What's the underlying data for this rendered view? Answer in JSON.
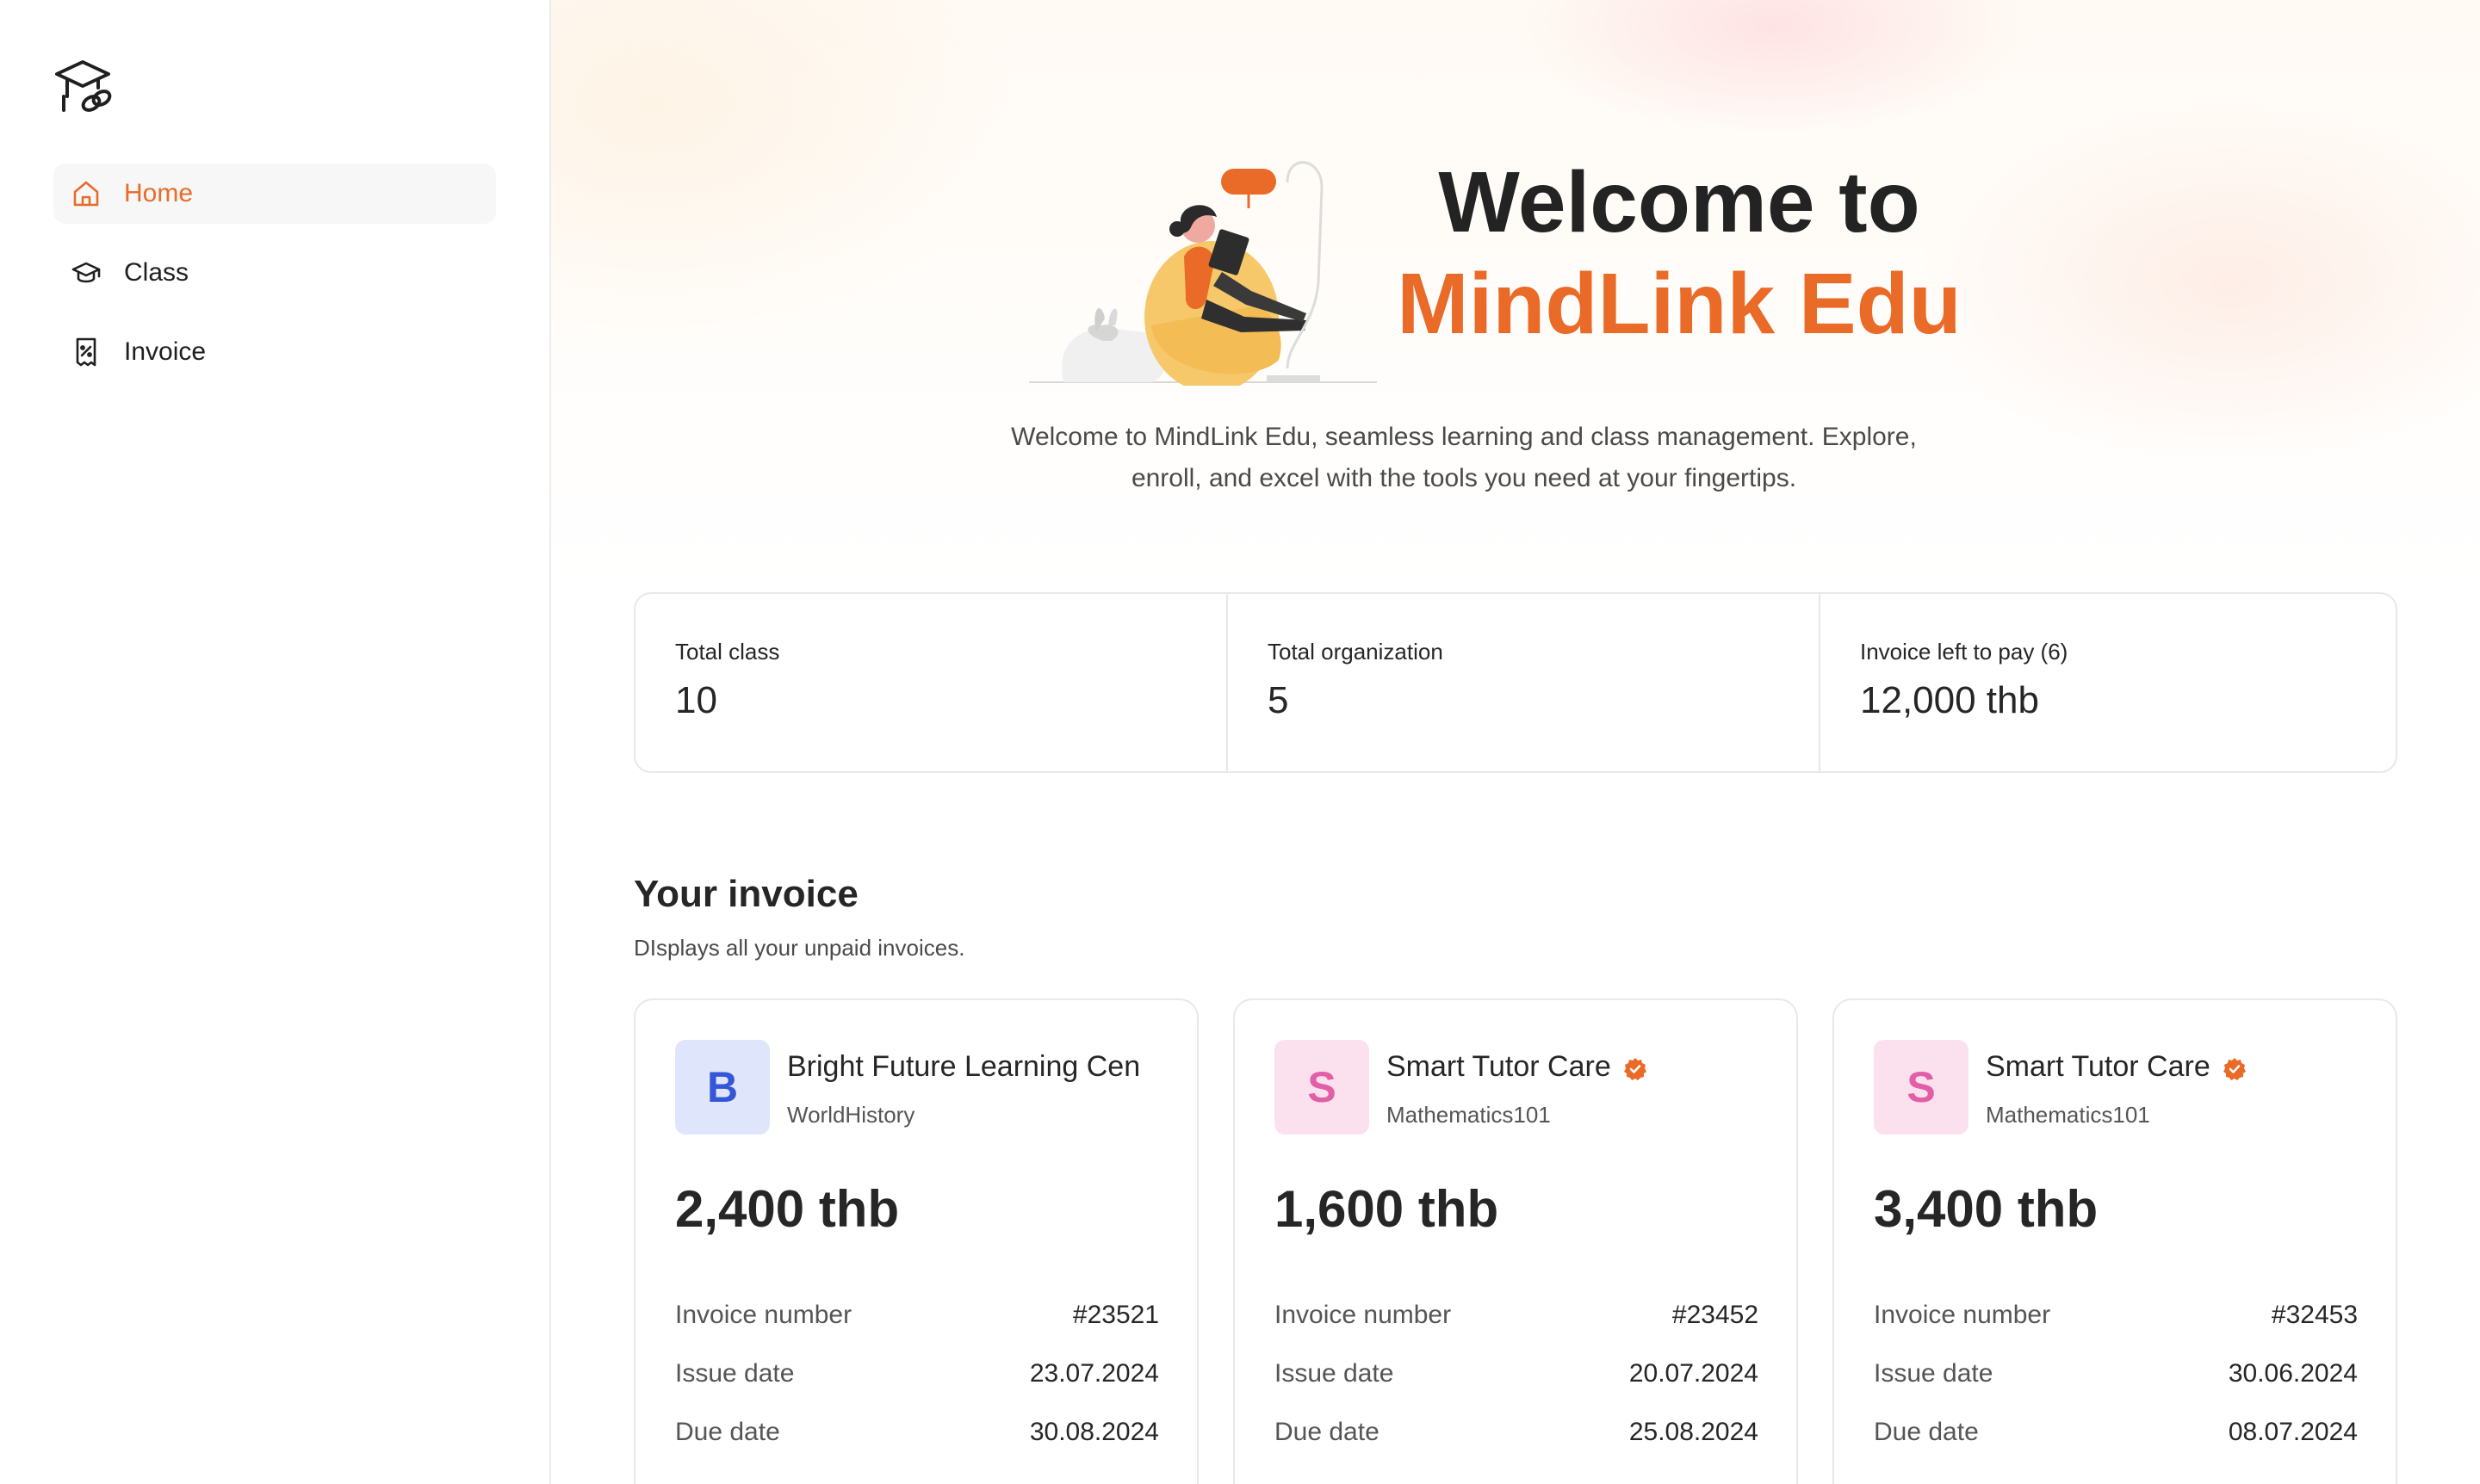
{
  "sidebar": {
    "logo_icon": "graduation-cap-link-icon",
    "items": [
      {
        "label": "Home",
        "icon": "home-icon",
        "active": true
      },
      {
        "label": "Class",
        "icon": "graduation-cap-icon",
        "active": false
      },
      {
        "label": "Invoice",
        "icon": "receipt-percent-icon",
        "active": false
      }
    ]
  },
  "hero": {
    "title_line1": "Welcome to",
    "title_line2": "MindLink Edu",
    "subtitle_line1": "Welcome to MindLink Edu, seamless learning and class management. Explore,",
    "subtitle_line2": "enroll, and excel with the tools you need at your fingertips."
  },
  "stats": [
    {
      "label": "Total class",
      "value": "10"
    },
    {
      "label": "Total organization",
      "value": "5"
    },
    {
      "label": "Invoice left to pay (6)",
      "value": "12,000 thb"
    }
  ],
  "invoices": {
    "title": "Your invoice",
    "subtitle": "DIsplays all your unpaid invoices.",
    "labels": {
      "number": "Invoice number",
      "issue": "Issue date",
      "due": "Due date"
    },
    "cards": [
      {
        "initial": "B",
        "name": "Bright Future Learning Cen",
        "verified": false,
        "class": "WorldHistory",
        "amount": "2,400 thb",
        "number": "#23521",
        "issue": "23.07.2024",
        "due": "30.08.2024",
        "avatar_bg": "#dfe6fb",
        "avatar_fg": "#3556d6"
      },
      {
        "initial": "S",
        "name": "Smart Tutor Care",
        "verified": true,
        "class": "Mathematics101",
        "amount": "1,600 thb",
        "number": "#23452",
        "issue": "20.07.2024",
        "due": "25.08.2024",
        "avatar_bg": "#fbe1ee",
        "avatar_fg": "#e25ea6"
      },
      {
        "initial": "S",
        "name": "Smart Tutor Care",
        "verified": true,
        "class": "Mathematics101",
        "amount": "3,400 thb",
        "number": "#32453",
        "issue": "30.06.2024",
        "due": "08.07.2024",
        "avatar_bg": "#fbe1ee",
        "avatar_fg": "#e25ea6"
      }
    ]
  },
  "colors": {
    "accent": "#ea6a28",
    "text": "#262626",
    "border": "#e8e8e8"
  }
}
